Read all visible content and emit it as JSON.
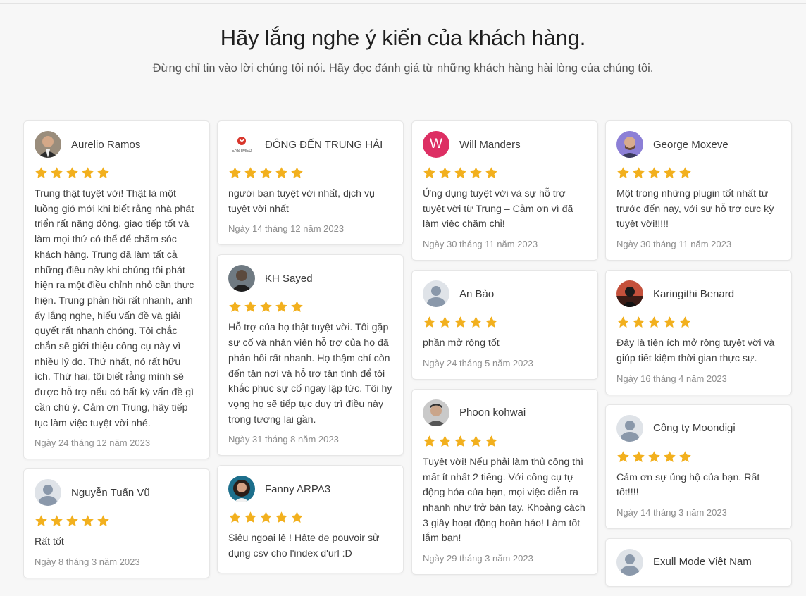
{
  "header": {
    "title": "Hãy lắng nghe ý kiến của khách hàng.",
    "subtitle": "Đừng chỉ tin vào lời chúng tôi nói. Hãy đọc đánh giá từ những khách hàng hài lòng của chúng tôi."
  },
  "colors": {
    "star": "#f2b01e",
    "avatar_letter_bg": "#dd2f63"
  },
  "reviews": {
    "c1r1": {
      "name": "Aurelio Ramos",
      "rating": 5,
      "text": "Trung thật tuyệt vời! Thật là một luồng gió mới khi biết rằng nhà phát triển rất năng động, giao tiếp tốt và làm mọi thứ có thể để chăm sóc khách hàng. Trung đã làm tất cả những điều này khi chúng tôi phát hiện ra một điều chỉnh nhỏ cần thực hiện. Trung phản hồi rất nhanh, anh ấy lắng nghe, hiểu vấn đề và giải quyết rất nhanh chóng. Tôi chắc chắn sẽ giới thiệu công cụ này vì nhiều lý do. Thứ nhất, nó rất hữu ích. Thứ hai, tôi biết rằng mình sẽ được hỗ trợ nếu có bất kỳ vấn đề gì cần chú ý. Cảm ơn Trung, hãy tiếp tục làm việc tuyệt vời nhé.",
      "date": "Ngày 24 tháng 12 năm 2023",
      "avatar": "photo"
    },
    "c1r2": {
      "name": "Nguyễn Tuấn Vũ",
      "rating": 5,
      "text": "Rất tốt",
      "date": "Ngày 8 tháng 3 năm 2023",
      "avatar": "generic"
    },
    "c2r1": {
      "name": "ĐÔNG ĐẾN TRUNG HẢI",
      "rating": 5,
      "text": "người bạn tuyệt vời nhất, dịch vụ tuyệt vời nhất",
      "date": "Ngày 14 tháng 12 năm 2023",
      "avatar": "logo",
      "logo_text": "EASTMED"
    },
    "c2r2": {
      "name": "KH Sayed",
      "rating": 5,
      "text": "Hỗ trợ của họ thật tuyệt vời. Tôi gặp sự cố và nhân viên hỗ trợ của họ đã phản hồi rất nhanh. Họ thậm chí còn đến tận nơi và hỗ trợ tận tình để tôi khắc phục sự cố ngay lập tức. Tôi hy vọng họ sẽ tiếp tục duy trì điều này trong tương lai gần.",
      "date": "Ngày 31 tháng 8 năm 2023",
      "avatar": "photo"
    },
    "c2r3": {
      "name": "Fanny ARPA3",
      "rating": 5,
      "text": "Siêu ngoại lệ ! Hâte de pouvoir sử dụng csv cho l'index d'url :D",
      "date": "",
      "avatar": "photo"
    },
    "c3r1": {
      "name": "Will Manders",
      "rating": 5,
      "text": "Ứng dụng tuyệt vời và sự hỗ trợ tuyệt vời từ Trung – Cảm ơn vì đã làm việc chăm chỉ!",
      "date": "Ngày 30 tháng 11 năm 2023",
      "avatar": "letter",
      "letter": "W"
    },
    "c3r2": {
      "name": "An Bảo",
      "rating": 5,
      "text": "phần mở rộng tốt",
      "date": "Ngày 24 tháng 5 năm 2023",
      "avatar": "generic"
    },
    "c3r3": {
      "name": "Phoon kohwai",
      "rating": 5,
      "text": "Tuyệt vời! Nếu phải làm thủ công thì mất ít nhất 2 tiếng. Với công cụ tự động hóa của bạn, mọi việc diễn ra nhanh như trở bàn tay. Khoảng cách 3 giây hoạt động hoàn hảo! Làm tốt lắm bạn!",
      "date": "Ngày 29 tháng 3 năm 2023",
      "avatar": "photo"
    },
    "c4r1": {
      "name": "George Moxeve",
      "rating": 5,
      "text": "Một trong những plugin tốt nhất từ trước đến nay, với sự hỗ trợ cực kỳ tuyệt vời!!!!!",
      "date": "Ngày 30 tháng 11 năm 2023",
      "avatar": "photo"
    },
    "c4r2": {
      "name": "Karingithi Benard",
      "rating": 5,
      "text": "Đây là tiện ích mở rộng tuyệt vời và giúp tiết kiệm thời gian thực sự.",
      "date": "Ngày 16 tháng 4 năm 2023",
      "avatar": "photo"
    },
    "c4r3": {
      "name": "Công ty Moondigi",
      "rating": 5,
      "text": "Cảm ơn sự ủng hộ của bạn. Rất tốt!!!!",
      "date": "Ngày 14 tháng 3 năm 2023",
      "avatar": "generic"
    },
    "c4r4": {
      "name": "Exull Mode Việt Nam",
      "rating": 5,
      "text": "",
      "date": "",
      "avatar": "generic"
    }
  }
}
